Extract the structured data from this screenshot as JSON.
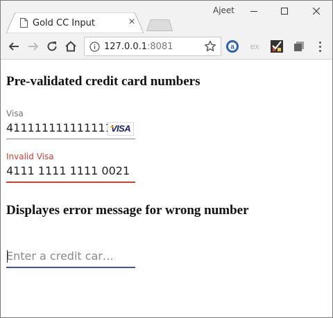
{
  "browser": {
    "tab_title": "Gold CC Input",
    "profile_name": "Ajeet",
    "url_host": "127.0.0.1",
    "url_port": ":8081",
    "extensions": [
      "a-extension-icon",
      "ex-extension-icon",
      "checklist-extension-icon",
      "layers-extension-icon"
    ],
    "ext_ex_label": "ex",
    "ext_a_label": "a"
  },
  "page": {
    "heading_prevalidated": "Pre-validated credit card numbers",
    "visa_field": {
      "label": "Visa",
      "value": "411111111111111",
      "card_brand": "VISA"
    },
    "invalid_field": {
      "label": "Invalid Visa",
      "value": "4111 1111 1111 0021"
    },
    "heading_error": "Displayes error message for wrong number",
    "empty_field": {
      "placeholder": "Enter a credit car…"
    }
  },
  "colors": {
    "error": "#d23f31",
    "focus": "#3f51b5",
    "visa_blue": "#1a1f71"
  }
}
